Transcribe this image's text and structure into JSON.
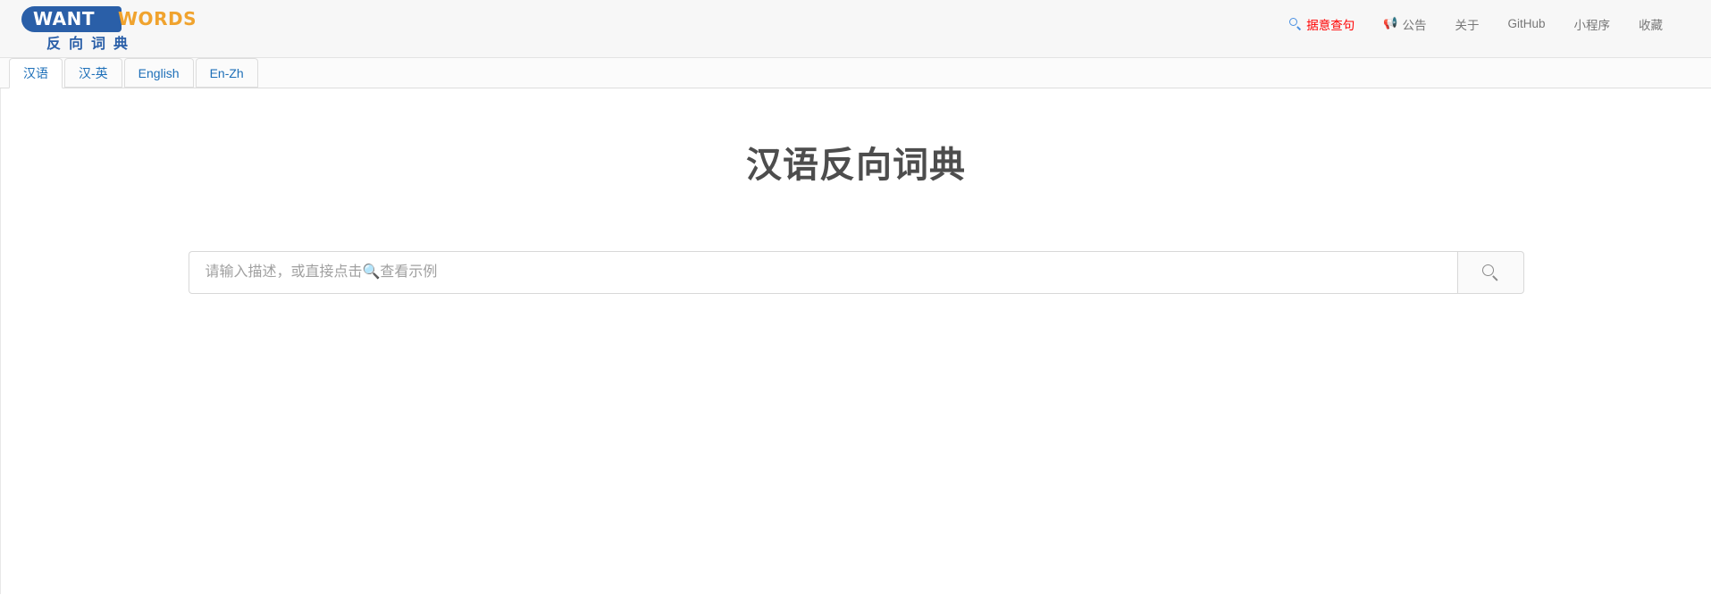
{
  "header": {
    "brand": {
      "word_blue": "WANT",
      "word_orange": "WORDS",
      "subtitle": "反向词典"
    },
    "nav_items": [
      {
        "label": "据意查句",
        "icon": "search-icon",
        "highlight": true,
        "color": "#ff0000"
      },
      {
        "label": "公告",
        "icon": "megaphone-icon",
        "highlight": false
      },
      {
        "label": "关于",
        "icon": null,
        "highlight": false
      },
      {
        "label": "GitHub",
        "icon": null,
        "highlight": false
      },
      {
        "label": "小程序",
        "icon": null,
        "highlight": false
      },
      {
        "label": "收藏",
        "icon": null,
        "highlight": false
      }
    ]
  },
  "tabs": [
    {
      "label": "汉语",
      "active": true
    },
    {
      "label": "汉-英",
      "active": false
    },
    {
      "label": "English",
      "active": false
    },
    {
      "label": "En-Zh",
      "active": false
    }
  ],
  "main": {
    "title": "汉语反向词典",
    "search": {
      "value": "",
      "placeholder": "请输入描述，或直接点击🔍查看示例",
      "button_icon": "search-icon"
    }
  },
  "colors": {
    "brand_blue": "#2a5fa8",
    "brand_orange": "#f0a32e",
    "tab_link": "#1d6fb8",
    "highlight_red": "#ff0000",
    "title_gray": "#4d4d4d",
    "header_bg": "#f7f7f7"
  }
}
